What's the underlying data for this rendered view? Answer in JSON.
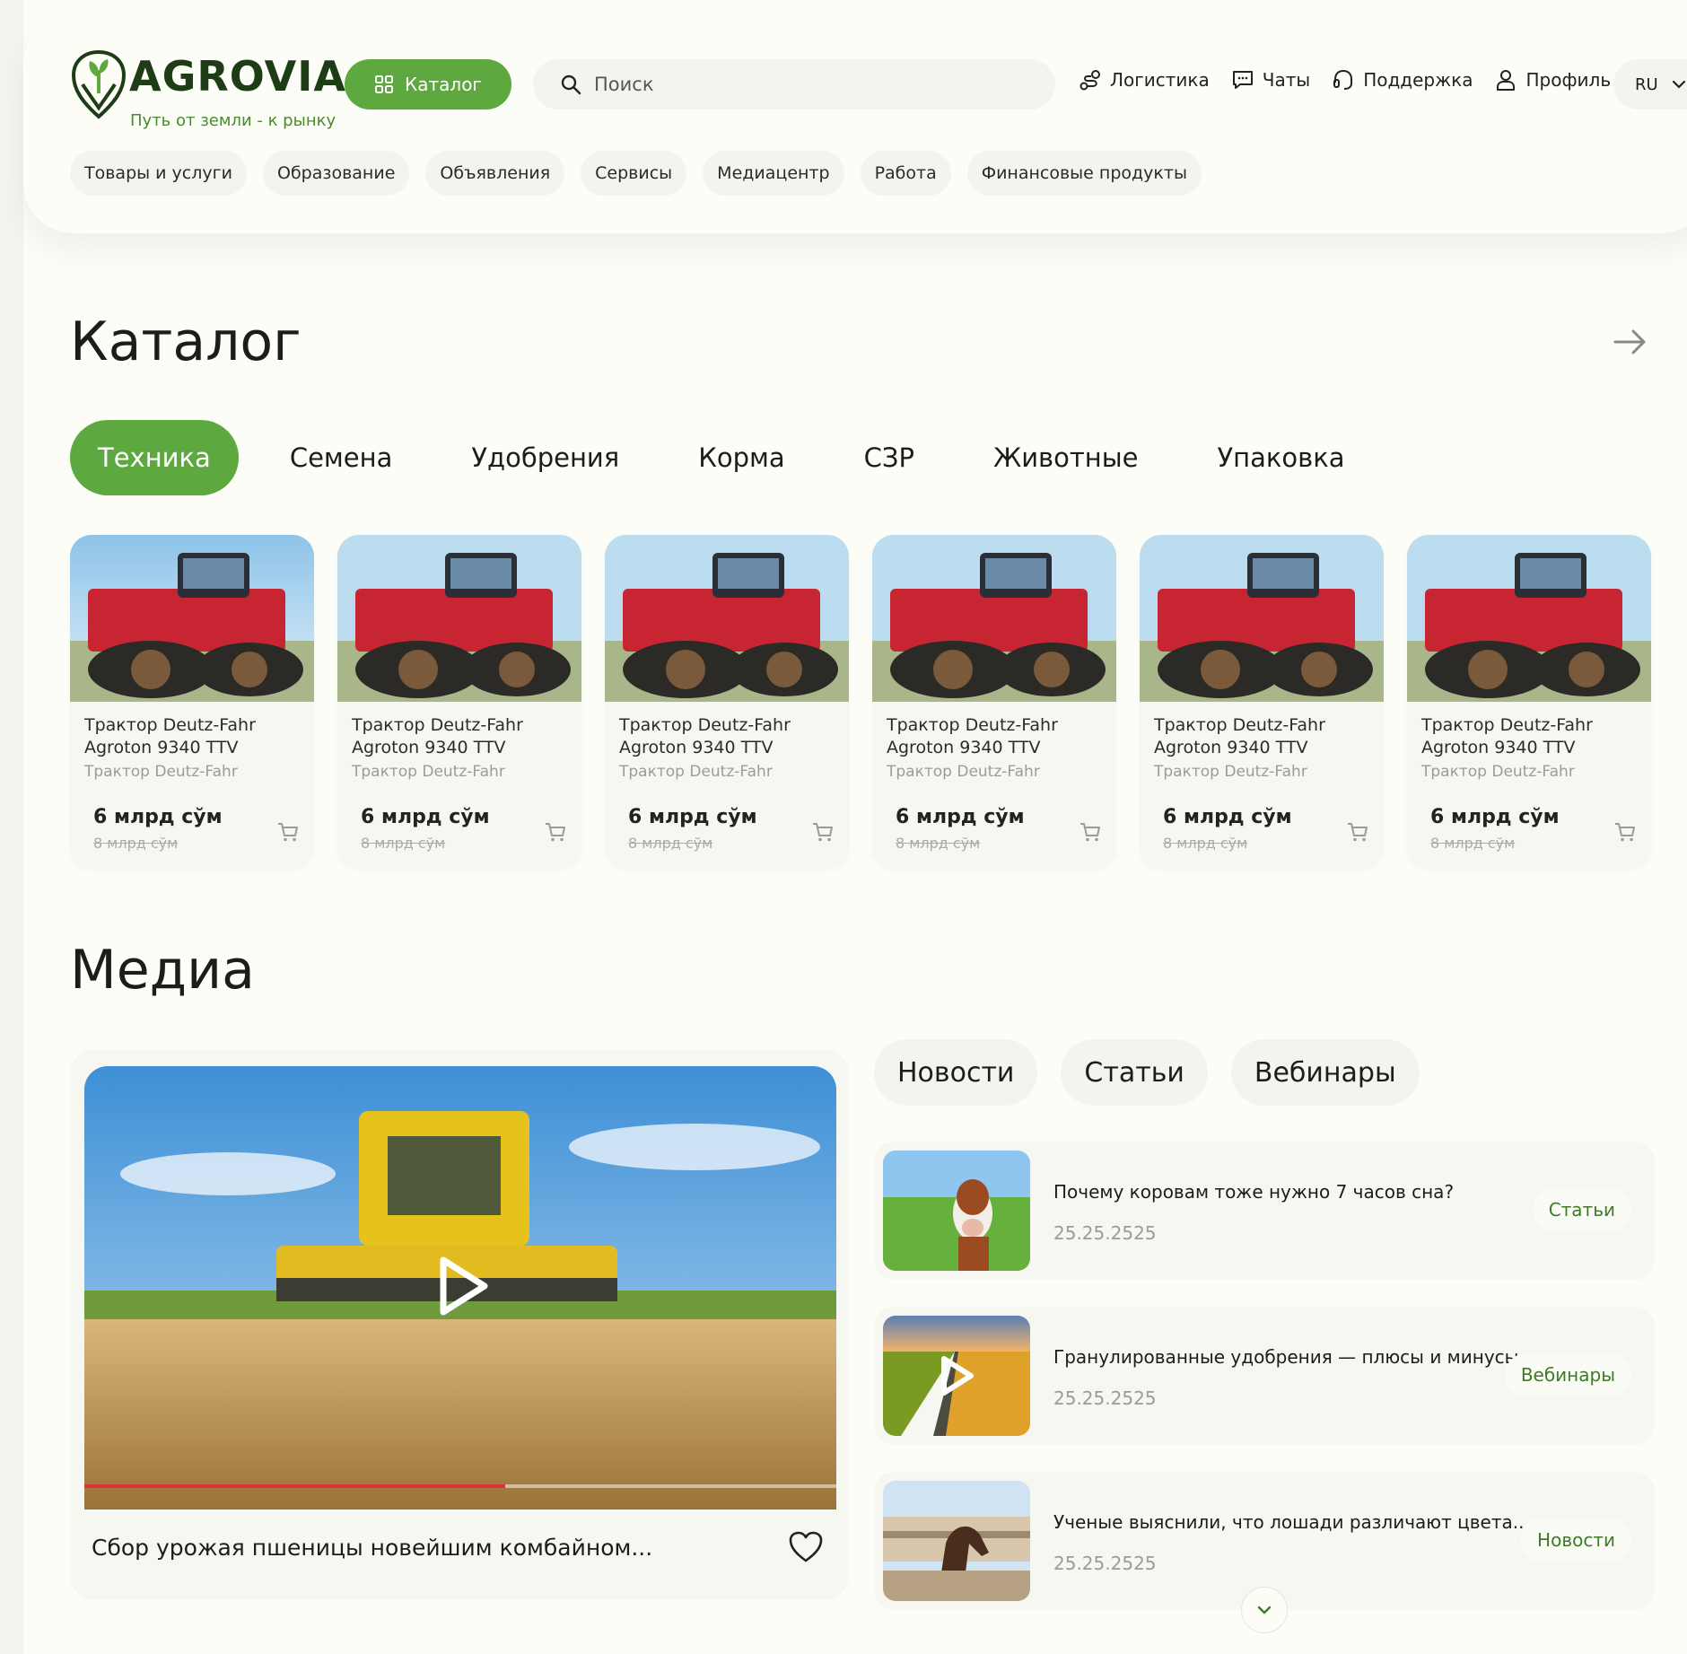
{
  "brand": {
    "name": "AGROVIA",
    "tagline": "Путь от земли - к рынку",
    "color": "#1e3d16",
    "accent": "#5da93f"
  },
  "header": {
    "catalog_button": "Каталог",
    "search_placeholder": "Поиск",
    "nav": {
      "logistics": "Логистика",
      "chats": "Чаты",
      "support": "Поддержка",
      "profile": "Профиль"
    },
    "language": "RU",
    "subnav": [
      "Товары и услуги",
      "Образование",
      "Объявления",
      "Сервисы",
      "Медиацентр",
      "Работа",
      "Финансовые продукты"
    ]
  },
  "catalog": {
    "title": "Каталог",
    "tabs": [
      "Техника",
      "Семена",
      "Удобрения",
      "Корма",
      "СЗР",
      "Животные",
      "Упаковка"
    ],
    "active_tab": 0,
    "products": [
      {
        "title": "Трактор Deutz-Fahr Agroton 9340 TTV",
        "subtitle": "Трактор Deutz-Fahr",
        "price": "6 млрд сўм",
        "old_price": "8 млрд сўм"
      },
      {
        "title": "Трактор Deutz-Fahr Agroton 9340 TTV",
        "subtitle": "Трактор Deutz-Fahr",
        "price": "6 млрд сўм",
        "old_price": "8 млрд сўм"
      },
      {
        "title": "Трактор Deutz-Fahr Agroton 9340 TTV",
        "subtitle": "Трактор Deutz-Fahr",
        "price": "6 млрд сўм",
        "old_price": "8 млрд сўм"
      },
      {
        "title": "Трактор Deutz-Fahr Agroton 9340 TTV",
        "subtitle": "Трактор Deutz-Fahr",
        "price": "6 млрд сўм",
        "old_price": "8 млрд сўм"
      },
      {
        "title": "Трактор Deutz-Fahr Agroton 9340 TTV",
        "subtitle": "Трактор Deutz-Fahr",
        "price": "6 млрд сўм",
        "old_price": "8 млрд сўм"
      },
      {
        "title": "Трактор Deutz-Fahr Agroton 9340 TTV",
        "subtitle": "Трактор Deutz-Fahr",
        "price": "6 млрд сўм",
        "old_price": "8 млрд сўм"
      }
    ]
  },
  "media": {
    "title": "Медиа",
    "featured_video": {
      "title": "Сбор урожая пшеницы новейшим комбайном...",
      "progress": 0.56
    },
    "tabs": [
      "Новости",
      "Статьи",
      "Вебинары"
    ],
    "items": [
      {
        "title": "Почему коровам тоже нужно 7 часов сна?",
        "date": "25.25.2525",
        "tag": "Статьи",
        "icon": "cow-photo"
      },
      {
        "title": "Гранулированные удобрения — плюсы и минусы...",
        "date": "25.25.2525",
        "tag": "Вебинары",
        "icon": "field-video"
      },
      {
        "title": "Ученые выяснили, что лошади различают цвета...",
        "date": "25.25.2525",
        "tag": "Новости",
        "icon": "horse-photo"
      }
    ]
  }
}
